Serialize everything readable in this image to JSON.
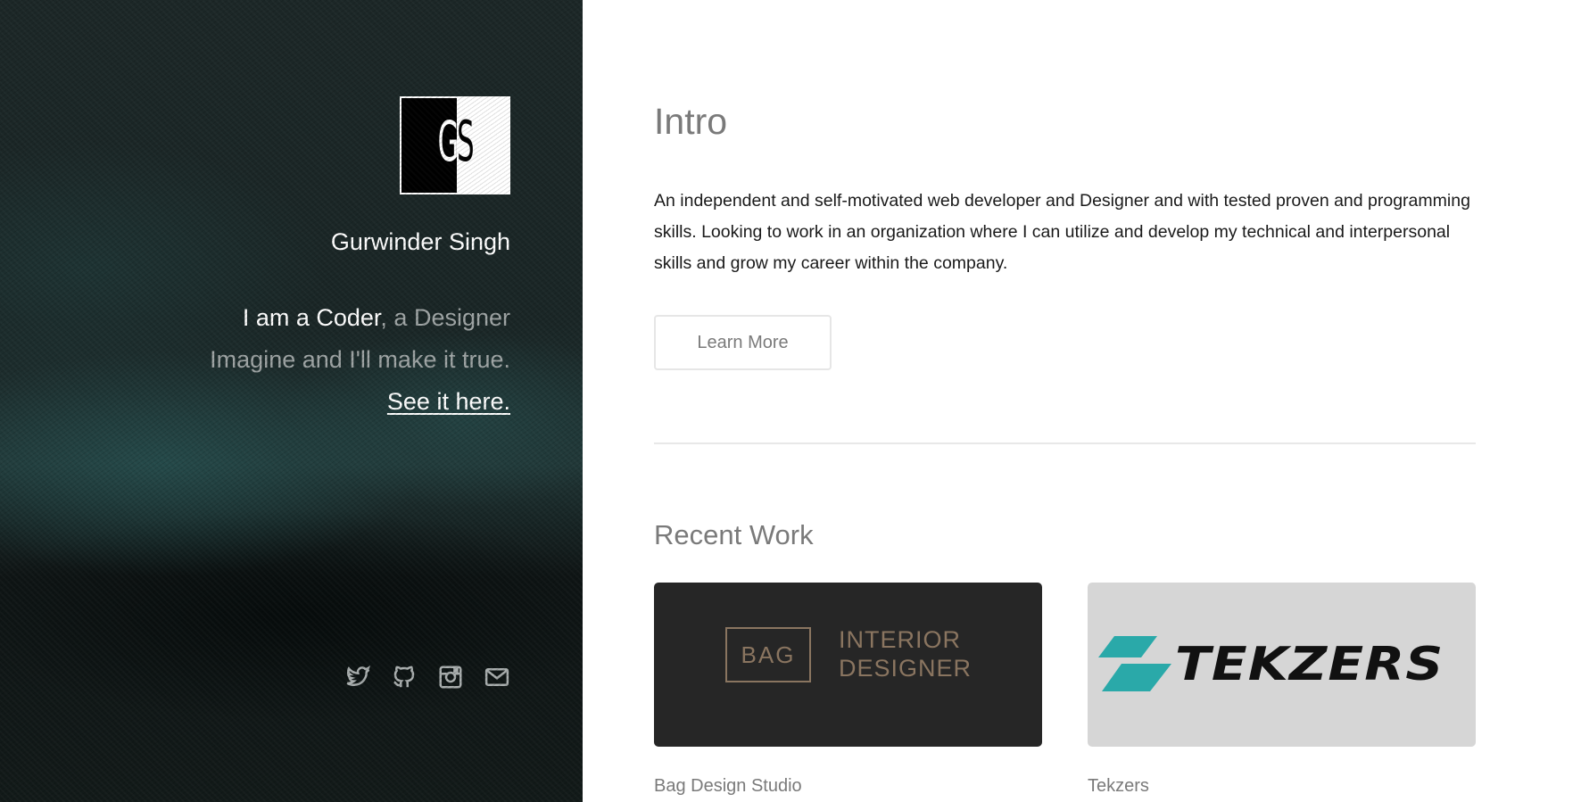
{
  "sidebar": {
    "logo_text": "GS",
    "name": "Gurwinder Singh",
    "tagline": {
      "part1": "I am a Coder",
      "part2": ", a Designer",
      "line2": "Imagine and I'll make it true.",
      "link": "See it here."
    },
    "social_icons": [
      "twitter-icon",
      "github-icon",
      "instagram-icon",
      "mail-icon"
    ]
  },
  "intro": {
    "heading": "Intro",
    "body": "An independent and self-motivated web developer and Designer and with tested proven and programming skills. Looking to work in an organization where I can utilize and develop my technical and interpersonal skills and grow my career within the company.",
    "button_label": "Learn More"
  },
  "recent_work": {
    "heading": "Recent Work",
    "items": [
      {
        "title": "Bag Design Studio",
        "thumb_box_text": "BAG",
        "thumb_line1": "INTERIOR",
        "thumb_line2": "DESIGNER"
      },
      {
        "title": "Tekzers",
        "thumb_text": "TEKZERS"
      }
    ]
  },
  "colors": {
    "sidebar_bg": "#1a2626",
    "heading_gray": "#7a7a7a",
    "bag_gold": "#8a7560",
    "tek_teal": "#2aa9a9"
  }
}
